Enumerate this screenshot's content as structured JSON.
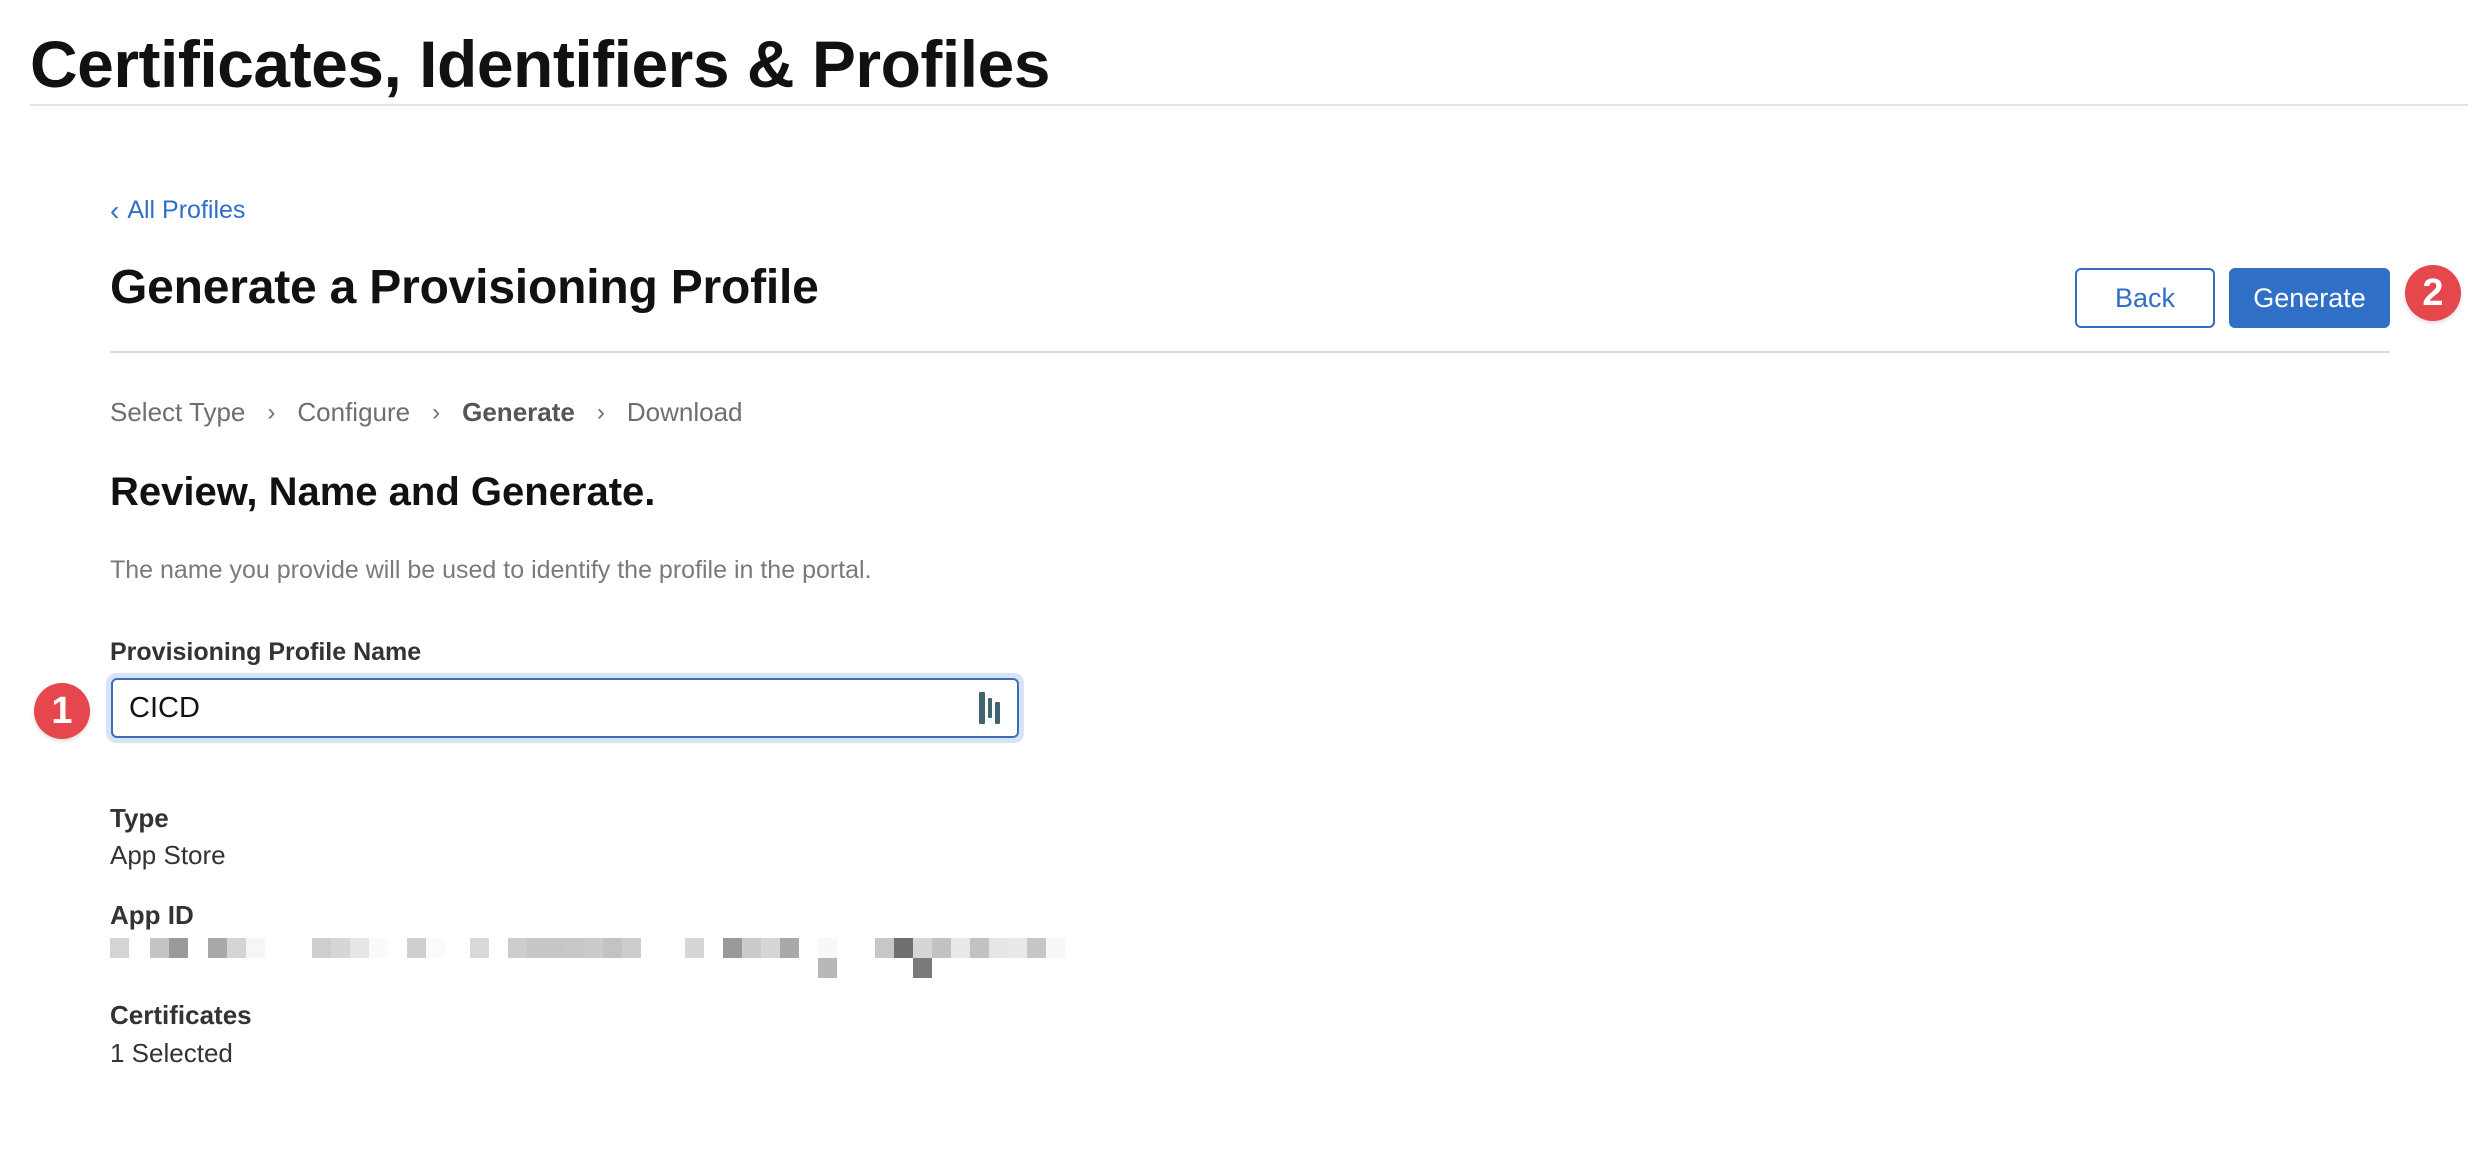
{
  "app": {
    "title": "Certificates, Identifiers & Profiles"
  },
  "nav": {
    "back_link_icon": "chevron-left-icon",
    "back_link_chevron": "‹",
    "back_link_label": "All Profiles"
  },
  "page": {
    "title": "Generate a Provisioning Profile",
    "actions": {
      "back_label": "Back",
      "generate_label": "Generate"
    }
  },
  "steps": [
    {
      "label": "Select Type",
      "active": false
    },
    {
      "label": "Configure",
      "active": false
    },
    {
      "label": "Generate",
      "active": true
    },
    {
      "label": "Download",
      "active": false
    }
  ],
  "step_separator": "›",
  "form": {
    "section_title": "Review, Name and Generate.",
    "helper_text": "The name you provide will be used to identify the profile in the portal.",
    "name_field": {
      "label": "Provisioning Profile Name",
      "value": "CICD",
      "trailing_icon": "password-manager-icon"
    }
  },
  "details": {
    "type": {
      "label": "Type",
      "value": "App Store"
    },
    "app_id": {
      "label": "App ID",
      "value": "[redacted]"
    },
    "certificates": {
      "label": "Certificates",
      "value": "1 Selected"
    }
  },
  "annotations": [
    {
      "number": "1",
      "target": "provisioning-profile-name-input"
    },
    {
      "number": "2",
      "target": "generate-button"
    }
  ],
  "colors": {
    "accent": "#2f6fc6",
    "annotation_badge": "#e5474c",
    "focus_ring": "#d7e4f5"
  }
}
